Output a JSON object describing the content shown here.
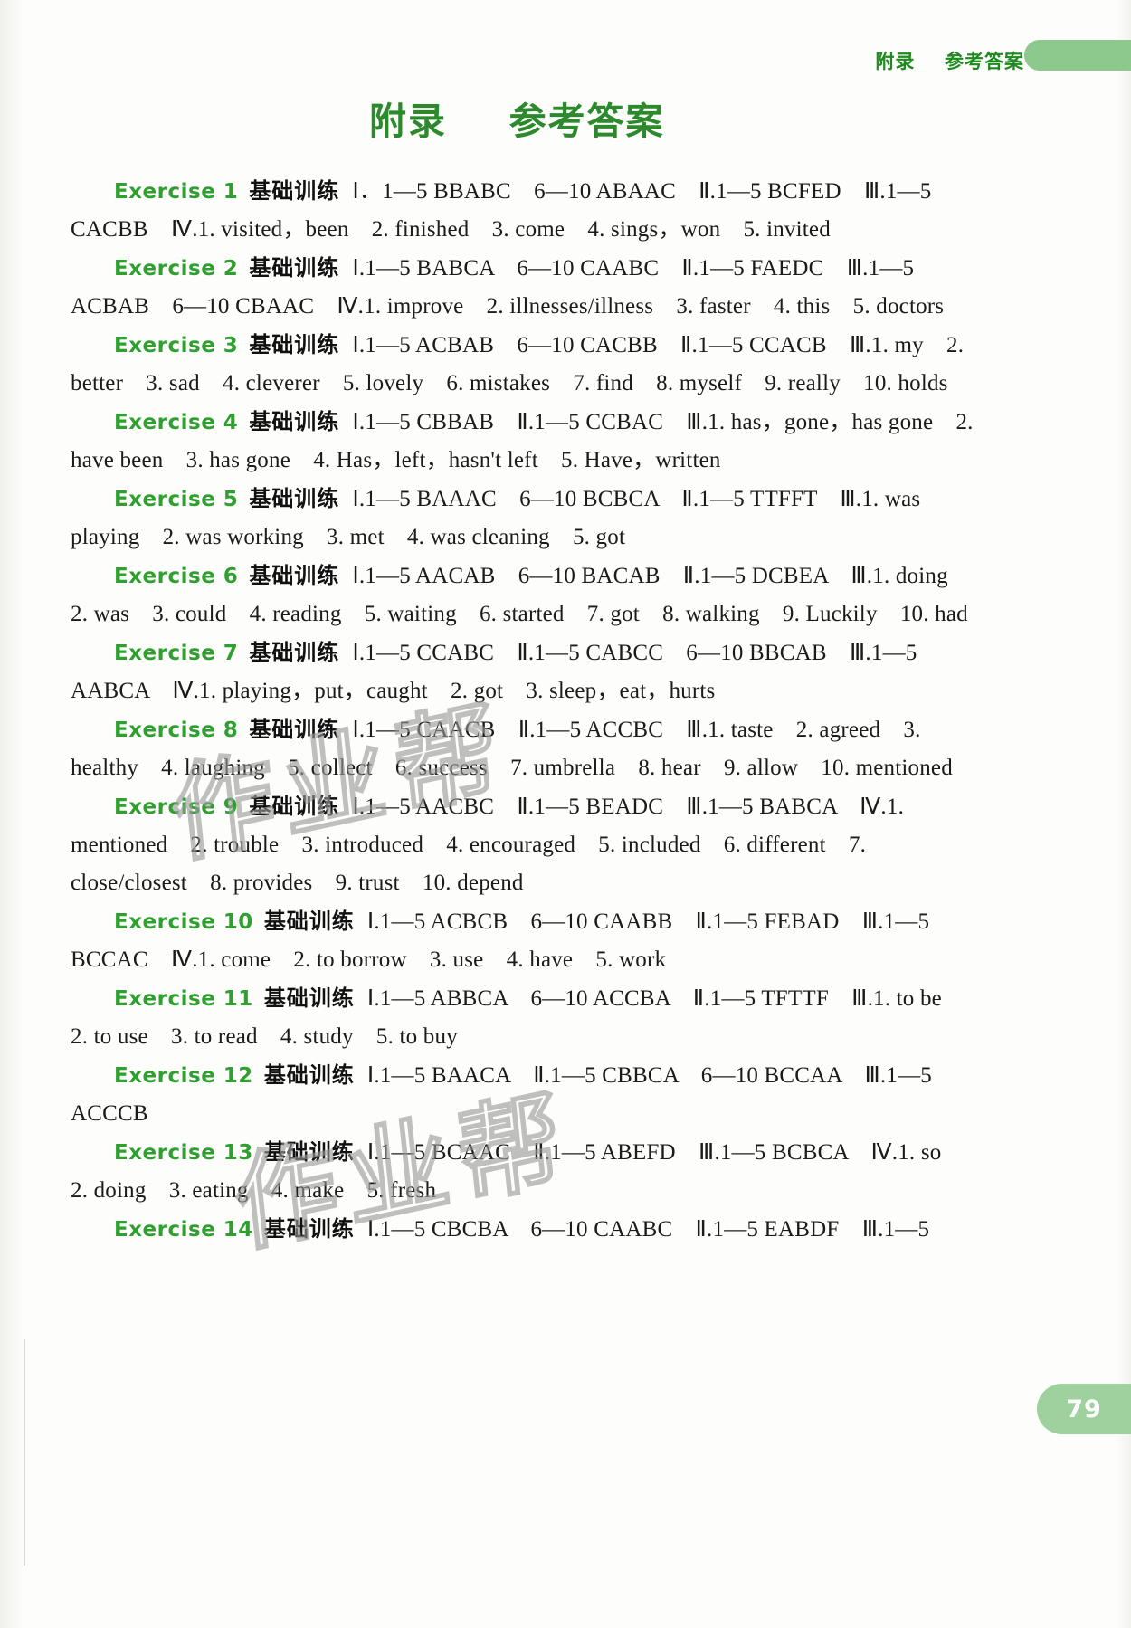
{
  "header": {
    "running_title_left": "附录",
    "running_title_right": "参考答案"
  },
  "title": {
    "part1": "附录",
    "part2": "参考答案"
  },
  "page": {
    "number": "79"
  },
  "watermark": {
    "line1": "作业帮",
    "line2": "作业帮"
  },
  "labels": {
    "practice_cn": "基础训练"
  },
  "exercises": [
    {
      "id": "Exercise 1",
      "label": "基础训练",
      "body": "Ⅰ．1—5 BBABC　6—10 ABAAC　Ⅱ.1—5 BCFED　Ⅲ.1—5 CACBB　Ⅳ.1. visited，been　2. finished　3. come　4. sings，won　5. invited"
    },
    {
      "id": "Exercise 2",
      "label": "基础训练",
      "body": "Ⅰ.1—5 BABCA　6—10 CAABC　Ⅱ.1—5 FAEDC　Ⅲ.1—5 ACBAB　6—10 CBAAC　Ⅳ.1. improve　2. illnesses/illness　3. faster　4. this　5. doctors"
    },
    {
      "id": "Exercise 3",
      "label": "基础训练",
      "body": "Ⅰ.1—5 ACBAB　6—10 CACBB　Ⅱ.1—5 CCACB　Ⅲ.1. my　2. better　3. sad　4. cleverer　5. lovely　6. mistakes　7. find　8. myself　9. really　10. holds"
    },
    {
      "id": "Exercise 4",
      "label": "基础训练",
      "body": "Ⅰ.1—5 CBBAB　Ⅱ.1—5 CCBAC　Ⅲ.1. has，gone，has gone　2. have been　3. has gone　4. Has，left，hasn't left　5. Have，written"
    },
    {
      "id": "Exercise 5",
      "label": "基础训练",
      "body": "Ⅰ.1—5 BAAAC　6—10 BCBCA　Ⅱ.1—5 TTFFT　Ⅲ.1. was playing　2. was working　3. met　4. was cleaning　5. got"
    },
    {
      "id": "Exercise 6",
      "label": "基础训练",
      "body": "Ⅰ.1—5 AACAB　6—10 BACAB　Ⅱ.1—5 DCBEA　Ⅲ.1. doing　2. was　3. could　4. reading　5. waiting　6. started　7. got　8. walking　9. Luckily　10. had"
    },
    {
      "id": "Exercise 7",
      "label": "基础训练",
      "body": "Ⅰ.1—5 CCABC　Ⅱ.1—5 CABCC　6—10 BBCAB　Ⅲ.1—5 AABCA　Ⅳ.1. playing，put，caught　2. got　3. sleep，eat，hurts"
    },
    {
      "id": "Exercise 8",
      "label": "基础训练",
      "body": "Ⅰ.1—5 CAACB　Ⅱ.1—5 ACCBC　Ⅲ.1. taste　2. agreed　3. healthy　4. laughing　5. collect　6. success　7. umbrella　8. hear　9. allow　10. mentioned"
    },
    {
      "id": "Exercise 9",
      "label": "基础训练",
      "body": "Ⅰ.1—5 AACBC　Ⅱ.1—5 BEADC　Ⅲ.1—5 BABCA　Ⅳ.1. mentioned　2. trouble　3. introduced　4. encouraged　5. included　6. different　7. close/closest　8. provides　9. trust　10. depend"
    },
    {
      "id": "Exercise 10",
      "label": "基础训练",
      "body": "Ⅰ.1—5 ACBCB　6—10 CAABB　Ⅱ.1—5 FEBAD　Ⅲ.1—5 BCCAC　Ⅳ.1. come　2. to borrow　3. use　4. have　5. work"
    },
    {
      "id": "Exercise 11",
      "label": "基础训练",
      "body": "Ⅰ.1—5 ABBCA　6—10 ACCBA　Ⅱ.1—5 TFTTF　Ⅲ.1. to be　2. to use　3. to read　4. study　5. to buy"
    },
    {
      "id": "Exercise 12",
      "label": "基础训练",
      "body": "Ⅰ.1—5 BAACA　Ⅱ.1—5 CBBCA　6—10 BCCAA　Ⅲ.1—5 ACCCB"
    },
    {
      "id": "Exercise 13",
      "label": "基础训练",
      "body": "Ⅰ.1—5 BCAAC　Ⅱ.1—5 ABEFD　Ⅲ.1—5 BCBCA　Ⅳ.1. so　2. doing　3. eating　4. make　5. fresh"
    },
    {
      "id": "Exercise 14",
      "label": "基础训练",
      "body": "Ⅰ.1—5 CBCBA　6—10 CAABC　Ⅱ.1—5 EABDF　Ⅲ.1—5"
    }
  ]
}
